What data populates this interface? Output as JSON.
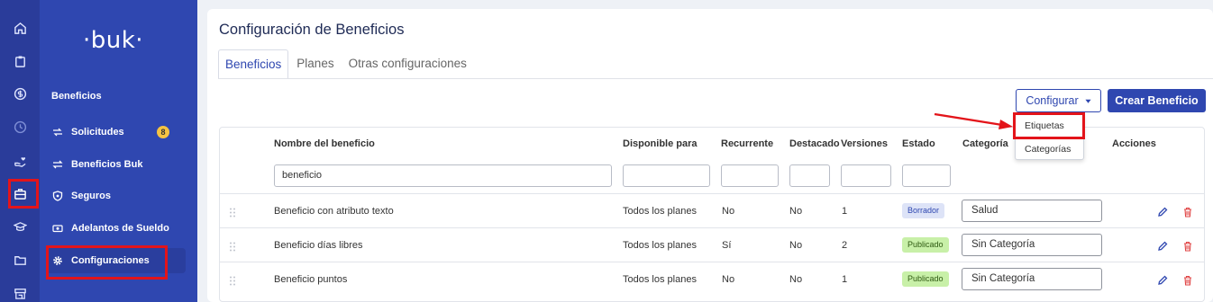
{
  "brand": {
    "logo": "·buk·"
  },
  "rail_icons": [
    "home-icon",
    "clipboard-icon",
    "dollar-icon",
    "clock-icon",
    "hand-heart-icon",
    "briefcase-icon",
    "graduation-cap-icon",
    "folder-icon",
    "store-icon"
  ],
  "sidebar": {
    "section_title": "Beneficios",
    "items": [
      {
        "label": "Solicitudes",
        "icon": "swap-icon",
        "badge": "8"
      },
      {
        "label": "Beneficios Buk",
        "icon": "exchange-icon"
      },
      {
        "label": "Seguros",
        "icon": "shield-icon"
      },
      {
        "label": "Adelantos de Sueldo",
        "icon": "cash-icon"
      },
      {
        "label": "Configuraciones",
        "icon": "gear-icon"
      }
    ]
  },
  "page": {
    "title": "Configuración de Beneficios",
    "tabs": [
      "Beneficios",
      "Planes",
      "Otras configuraciones"
    ]
  },
  "toolbar": {
    "configurar_label": "Configurar",
    "crear_label": "Crear Beneficio"
  },
  "dropdown": {
    "items": [
      "Etiquetas",
      "Categorías"
    ]
  },
  "table": {
    "headers": [
      "Nombre del beneficio",
      "Disponible para",
      "Recurrente",
      "Destacado",
      "Versiones",
      "Estado",
      "Categoría",
      "Acciones"
    ],
    "filter_values": {
      "name": "beneficio"
    },
    "rows": [
      {
        "name": "Beneficio con atributo texto",
        "available": "Todos los planes",
        "recurring": "No",
        "featured": "No",
        "versions": "1",
        "status": "Borrador",
        "category": "Salud"
      },
      {
        "name": "Beneficio días libres",
        "available": "Todos los planes",
        "recurring": "Sí",
        "featured": "No",
        "versions": "2",
        "status": "Publicado",
        "category": "Sin Categoría"
      },
      {
        "name": "Beneficio puntos",
        "available": "Todos los planes",
        "recurring": "No",
        "featured": "No",
        "versions": "1",
        "status": "Publicado",
        "category": "Sin Categoría"
      }
    ]
  },
  "colors": {
    "primary": "#2f47b0",
    "rail": "#2a3c9a",
    "highlight": "#e3141a",
    "badge": "#f5c342",
    "published": "#c8f0a8",
    "draft": "#dde3f7"
  }
}
